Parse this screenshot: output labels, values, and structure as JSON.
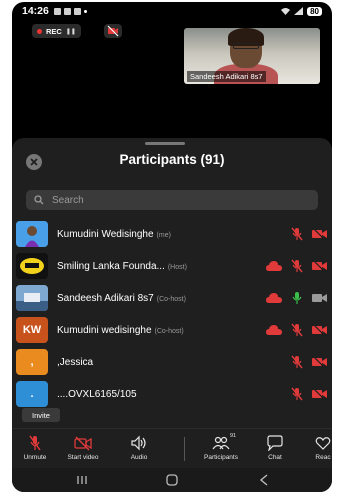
{
  "status_bar": {
    "time": "14:26",
    "battery": "80"
  },
  "recording": {
    "label": "REC"
  },
  "self_view": {
    "name": "Sandeesh Adikari 8s7"
  },
  "panel": {
    "title": "Participants (91)",
    "search_placeholder": "Search"
  },
  "participants": [
    {
      "name": "Kumudini Wedisinghe",
      "role": "(me)",
      "audio": "muted",
      "video": "off"
    },
    {
      "name": "Smiling Lanka Founda...",
      "role": "(Host)",
      "audio": "muted",
      "video": "off"
    },
    {
      "name": "Sandeesh Adikari 8s7",
      "role": "(Co-host)",
      "audio": "unmuted",
      "video": "on"
    },
    {
      "name": "Kumudini wedisinghe",
      "role": "(Co-host)",
      "avatar_text": "KW",
      "audio": "muted",
      "video": "off"
    },
    {
      "name": ",Jessica",
      "role": "",
      "avatar_text": ",",
      "audio": "muted",
      "video": "off"
    },
    {
      "name": "....OVXL6165/105",
      "role": "",
      "avatar_text": ".",
      "audio": "muted",
      "video": "off"
    }
  ],
  "invite": {
    "label": "Invite"
  },
  "toolbar": {
    "unmute": "Unmute",
    "start_video": "Start video",
    "audio": "Audio",
    "participants": "Participants",
    "participants_count": "91",
    "chat": "Chat",
    "react": "Reac"
  },
  "colors": {
    "accent_red": "#e03a3a",
    "green": "#3bbf4a",
    "panel": "#1f1f1f",
    "kw_avatar": "#c8521c",
    "orange_avatar": "#e98b1f",
    "blue_avatar": "#2e8fd6"
  }
}
